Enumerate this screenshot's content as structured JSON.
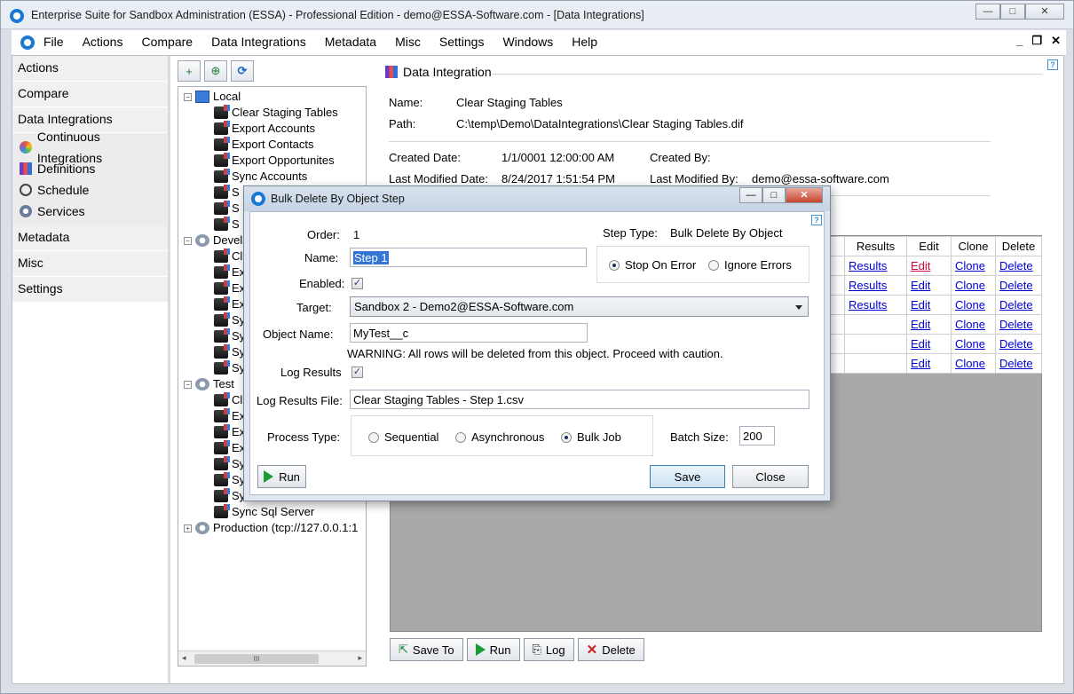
{
  "window": {
    "title": "Enterprise Suite for Sandbox Administration (ESSA) - Professional Edition - demo@ESSA-Software.com - [Data Integrations]",
    "controls": {
      "minimize": "—",
      "maximize": "□",
      "close": "✕"
    }
  },
  "menu": {
    "items": [
      "File",
      "Actions",
      "Compare",
      "Data Integrations",
      "Metadata",
      "Misc",
      "Settings",
      "Windows",
      "Help"
    ],
    "mdi": {
      "minimize": "_",
      "restore": "❐",
      "close": "✕"
    }
  },
  "nav": {
    "sections_top": [
      "Actions",
      "Compare",
      "Data Integrations"
    ],
    "sub_items": [
      "Continuous Integrations",
      "Definitions",
      "Schedule",
      "Services"
    ],
    "sections_bottom": [
      "Metadata",
      "Misc",
      "Settings"
    ]
  },
  "tree_toolbar": {
    "add": "+",
    "add_node": "⊕",
    "refresh": "⟳"
  },
  "tree": {
    "nodes": [
      {
        "label": "Local",
        "level": 0,
        "expander": "−",
        "icon": "computer-icon"
      },
      {
        "label": "Clear Staging Tables",
        "level": 1,
        "icon": "integration-icon"
      },
      {
        "label": "Export Accounts",
        "level": 1,
        "icon": "integration-icon"
      },
      {
        "label": "Export Contacts",
        "level": 1,
        "icon": "integration-icon"
      },
      {
        "label": "Export Opportunites",
        "level": 1,
        "icon": "integration-icon"
      },
      {
        "label": "Sync Accounts",
        "level": 1,
        "icon": "integration-icon"
      },
      {
        "label": "S",
        "level": 1,
        "icon": "integration-icon"
      },
      {
        "label": "S",
        "level": 1,
        "icon": "integration-icon"
      },
      {
        "label": "S",
        "level": 1,
        "icon": "integration-icon"
      },
      {
        "label": "Devel",
        "level": 0,
        "expander": "−",
        "icon": "gear-icon"
      },
      {
        "label": "Cl",
        "level": 1,
        "icon": "integration-icon"
      },
      {
        "label": "Ex",
        "level": 1,
        "icon": "integration-icon"
      },
      {
        "label": "Ex",
        "level": 1,
        "icon": "integration-icon"
      },
      {
        "label": "Ex",
        "level": 1,
        "icon": "integration-icon"
      },
      {
        "label": "Sy",
        "level": 1,
        "icon": "integration-icon"
      },
      {
        "label": "Sy",
        "level": 1,
        "icon": "integration-icon"
      },
      {
        "label": "Sy",
        "level": 1,
        "icon": "integration-icon"
      },
      {
        "label": "Sy",
        "level": 1,
        "icon": "integration-icon"
      },
      {
        "label": "Test",
        "level": 0,
        "expander": "−",
        "icon": "gear-icon"
      },
      {
        "label": "Cl",
        "level": 1,
        "icon": "integration-icon"
      },
      {
        "label": "Ex",
        "level": 1,
        "icon": "integration-icon"
      },
      {
        "label": "Ex",
        "level": 1,
        "icon": "integration-icon"
      },
      {
        "label": "Ex",
        "level": 1,
        "icon": "integration-icon"
      },
      {
        "label": "Sy",
        "level": 1,
        "icon": "integration-icon"
      },
      {
        "label": "Sy",
        "level": 1,
        "icon": "integration-icon"
      },
      {
        "label": "Sy",
        "level": 1,
        "icon": "integration-icon"
      },
      {
        "label": "Sync Sql Server",
        "level": 1,
        "icon": "integration-icon"
      },
      {
        "label": "Production (tcp://127.0.0.1:1",
        "level": 0,
        "expander": "+",
        "icon": "gear-icon"
      }
    ],
    "scroll_grip": "III"
  },
  "detail": {
    "header": "Data Integration",
    "help": "?",
    "name_label": "Name:",
    "name_value": "Clear Staging Tables",
    "path_label": "Path:",
    "path_value": "C:\\temp\\Demo\\DataIntegrations\\Clear Staging Tables.dif",
    "created_date_label": "Created Date:",
    "created_date_value": "1/1/0001 12:00:00 AM",
    "created_by_label": "Created By:",
    "created_by_value": "",
    "modified_date_label": "Last Modified Date:",
    "modified_date_value": "8/24/2017 1:51:54 PM",
    "modified_by_label": "Last Modified By:",
    "modified_by_value": "demo@essa-software.com"
  },
  "grid": {
    "columns": [
      "Results",
      "Edit",
      "Clone",
      "Delete"
    ],
    "rows": [
      {
        "results": "Results",
        "edit": "Edit",
        "clone": "Clone",
        "delete": "Delete"
      },
      {
        "results": "Results",
        "edit": "Edit",
        "clone": "Clone",
        "delete": "Delete"
      },
      {
        "results": "Results",
        "edit": "Edit",
        "clone": "Clone",
        "delete": "Delete"
      },
      {
        "results": "",
        "edit": "Edit",
        "clone": "Clone",
        "delete": "Delete"
      },
      {
        "results": "",
        "edit": "Edit",
        "clone": "Clone",
        "delete": "Delete"
      },
      {
        "results": "",
        "edit": "Edit",
        "clone": "Clone",
        "delete": "Delete"
      }
    ]
  },
  "bottom_toolbar": {
    "save_to": "Save To",
    "run": "Run",
    "log": "Log",
    "delete": "Delete"
  },
  "dialog": {
    "title": "Bulk Delete By Object Step",
    "help": "?",
    "order_label": "Order:",
    "order_value": "1",
    "step_type_label": "Step Type:",
    "step_type_value": "Bulk Delete By Object",
    "name_label": "Name:",
    "name_value": "Step 1",
    "stop_on_error": "Stop On Error",
    "ignore_errors": "Ignore Errors",
    "error_mode_selected": "stop",
    "enabled_label": "Enabled:",
    "enabled_checked": true,
    "target_label": "Target:",
    "target_value": "Sandbox 2 - Demo2@ESSA-Software.com",
    "object_name_label": "Object Name:",
    "object_name_value": "MyTest__c",
    "warning": "WARNING: All rows will be deleted from this object. Proceed with caution.",
    "log_results_label": "Log Results",
    "log_results_checked": true,
    "log_file_label": "Log Results File:",
    "log_file_value": "Clear Staging Tables - Step 1.csv",
    "process_type_label": "Process Type:",
    "process_options": [
      "Sequential",
      "Asynchronous",
      "Bulk Job"
    ],
    "process_selected": "Bulk Job",
    "batch_size_label": "Batch Size:",
    "batch_size_value": "200",
    "run_label": "Run",
    "save_label": "Save",
    "close_label": "Close",
    "check_mark": "✓"
  }
}
